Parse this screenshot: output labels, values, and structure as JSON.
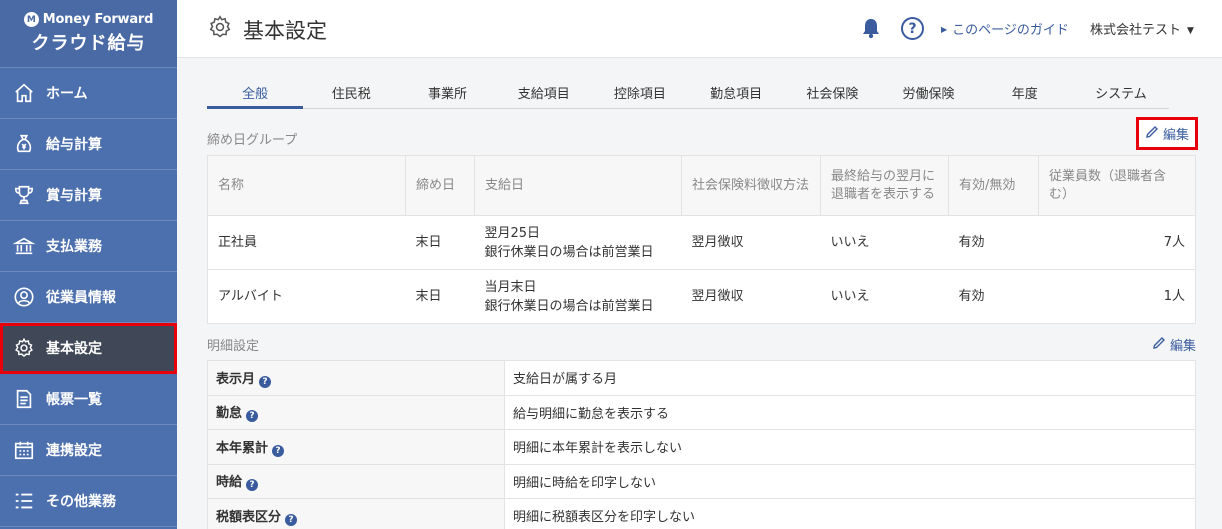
{
  "sidebar": {
    "brand": "Money Forward",
    "product": "クラウド給与",
    "items": [
      {
        "label": "ホーム",
        "icon": "home-icon"
      },
      {
        "label": "給与計算",
        "icon": "yen-bag-icon"
      },
      {
        "label": "賞与計算",
        "icon": "trophy-icon"
      },
      {
        "label": "支払業務",
        "icon": "bank-icon"
      },
      {
        "label": "従業員情報",
        "icon": "employee-icon"
      },
      {
        "label": "基本設定",
        "icon": "gear-icon",
        "active": true
      },
      {
        "label": "帳票一覧",
        "icon": "document-icon"
      },
      {
        "label": "連携設定",
        "icon": "calendar-icon"
      },
      {
        "label": "その他業務",
        "icon": "list-icon"
      }
    ]
  },
  "header": {
    "title": "基本設定",
    "help": "?",
    "guide": "このページのガイド",
    "company": "株式会社テスト"
  },
  "tabs": [
    "全般",
    "住民税",
    "事業所",
    "支給項目",
    "控除項目",
    "勤怠項目",
    "社会保険",
    "労働保険",
    "年度",
    "システム"
  ],
  "closing_group": {
    "title": "締め日グループ",
    "edit": "編集",
    "columns": [
      "名称",
      "締め日",
      "支給日",
      "社会保険料徴収方法",
      "最終給与の翌月に退職者を表示する",
      "有効/無効",
      "従業員数（退職者含む）"
    ],
    "rows": [
      {
        "name": "正社員",
        "closing": "末日",
        "pay1": "翌月25日",
        "pay2": "銀行休業日の場合は前営業日",
        "insurance": "翌月徴収",
        "show_retired": "いいえ",
        "status": "有効",
        "count": "7人"
      },
      {
        "name": "アルバイト",
        "closing": "末日",
        "pay1": "当月末日",
        "pay2": "銀行休業日の場合は前営業日",
        "insurance": "翌月徴収",
        "show_retired": "いいえ",
        "status": "有効",
        "count": "1人"
      }
    ]
  },
  "detail": {
    "title": "明細設定",
    "edit": "編集",
    "rows": [
      {
        "label": "表示月",
        "value": "支給日が属する月"
      },
      {
        "label": "勤怠",
        "value": "給与明細に勤怠を表示する"
      },
      {
        "label": "本年累計",
        "value": "明細に本年累計を表示しない"
      },
      {
        "label": "時給",
        "value": "明細に時給を印字しない"
      },
      {
        "label": "税額表区分",
        "value": "明細に税額表区分を印字しない"
      }
    ]
  },
  "colors": {
    "sidebar": "#4c6fae",
    "active_nav": "#404756",
    "accent": "#3a5c9f",
    "highlight": "#e8000b"
  }
}
